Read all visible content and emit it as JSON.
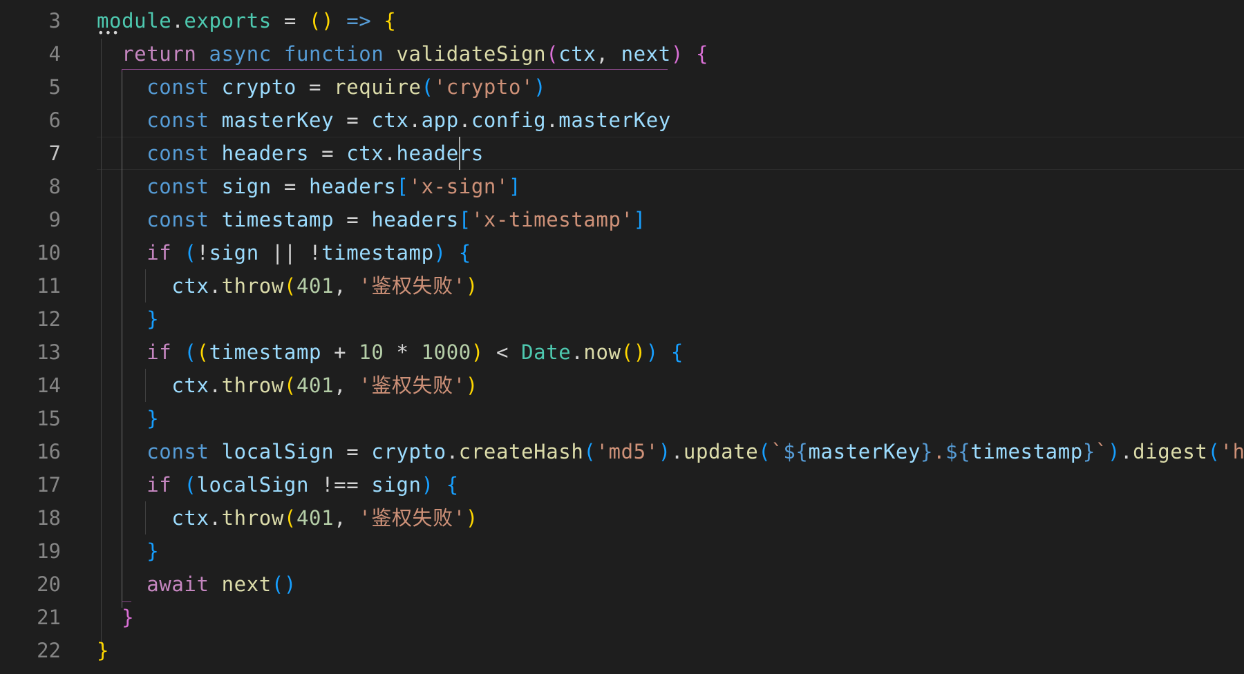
{
  "editor": {
    "active_line": 7,
    "line_numbers": [
      "3",
      "4",
      "5",
      "6",
      "7",
      "8",
      "9",
      "10",
      "11",
      "12",
      "13",
      "14",
      "15",
      "16",
      "17",
      "18",
      "19",
      "20",
      "21",
      "22"
    ],
    "lines": [
      [
        [
          "module",
          "t-type"
        ],
        [
          ".",
          "t-op"
        ],
        [
          "exports",
          "t-type"
        ],
        [
          " = ",
          "t-op"
        ],
        [
          "()",
          "t-b1"
        ],
        [
          " => ",
          "t-kw"
        ],
        [
          "{",
          "t-b1"
        ]
      ],
      [
        [
          "  ",
          "t-op"
        ],
        [
          "return",
          "t-ctl"
        ],
        [
          " ",
          "t-op"
        ],
        [
          "async",
          "t-kw"
        ],
        [
          " ",
          "t-op"
        ],
        [
          "function",
          "t-kw"
        ],
        [
          " ",
          "t-op"
        ],
        [
          "validateSign",
          "t-fn"
        ],
        [
          "(",
          "t-b2"
        ],
        [
          "ctx",
          "t-var"
        ],
        [
          ", ",
          "t-op"
        ],
        [
          "next",
          "t-var"
        ],
        [
          ")",
          "t-b2"
        ],
        [
          " ",
          "t-op"
        ],
        [
          "{",
          "t-b2"
        ]
      ],
      [
        [
          "    ",
          "t-op"
        ],
        [
          "const",
          "t-kw"
        ],
        [
          " ",
          "t-op"
        ],
        [
          "crypto",
          "t-var"
        ],
        [
          " = ",
          "t-op"
        ],
        [
          "require",
          "t-fn"
        ],
        [
          "(",
          "t-b3"
        ],
        [
          "'crypto'",
          "t-str"
        ],
        [
          ")",
          "t-b3"
        ]
      ],
      [
        [
          "    ",
          "t-op"
        ],
        [
          "const",
          "t-kw"
        ],
        [
          " ",
          "t-op"
        ],
        [
          "masterKey",
          "t-var"
        ],
        [
          " = ",
          "t-op"
        ],
        [
          "ctx",
          "t-var"
        ],
        [
          ".",
          "t-op"
        ],
        [
          "app",
          "t-var"
        ],
        [
          ".",
          "t-op"
        ],
        [
          "config",
          "t-var"
        ],
        [
          ".",
          "t-op"
        ],
        [
          "masterKey",
          "t-var"
        ]
      ],
      [
        [
          "    ",
          "t-op"
        ],
        [
          "const",
          "t-kw"
        ],
        [
          " ",
          "t-op"
        ],
        [
          "headers",
          "t-var"
        ],
        [
          " = ",
          "t-op"
        ],
        [
          "ctx",
          "t-var"
        ],
        [
          ".",
          "t-op"
        ],
        [
          "headers",
          "t-var"
        ]
      ],
      [
        [
          "    ",
          "t-op"
        ],
        [
          "const",
          "t-kw"
        ],
        [
          " ",
          "t-op"
        ],
        [
          "sign",
          "t-var"
        ],
        [
          " = ",
          "t-op"
        ],
        [
          "headers",
          "t-var"
        ],
        [
          "[",
          "t-b3"
        ],
        [
          "'x-sign'",
          "t-str"
        ],
        [
          "]",
          "t-b3"
        ]
      ],
      [
        [
          "    ",
          "t-op"
        ],
        [
          "const",
          "t-kw"
        ],
        [
          " ",
          "t-op"
        ],
        [
          "timestamp",
          "t-var"
        ],
        [
          " = ",
          "t-op"
        ],
        [
          "headers",
          "t-var"
        ],
        [
          "[",
          "t-b3"
        ],
        [
          "'x-timestamp'",
          "t-str"
        ],
        [
          "]",
          "t-b3"
        ]
      ],
      [
        [
          "    ",
          "t-op"
        ],
        [
          "if",
          "t-ctl"
        ],
        [
          " ",
          "t-op"
        ],
        [
          "(",
          "t-b3"
        ],
        [
          "!",
          "t-op"
        ],
        [
          "sign",
          "t-var"
        ],
        [
          " || ",
          "t-op"
        ],
        [
          "!",
          "t-op"
        ],
        [
          "timestamp",
          "t-var"
        ],
        [
          ")",
          "t-b3"
        ],
        [
          " ",
          "t-op"
        ],
        [
          "{",
          "t-b3"
        ]
      ],
      [
        [
          "      ",
          "t-op"
        ],
        [
          "ctx",
          "t-var"
        ],
        [
          ".",
          "t-op"
        ],
        [
          "throw",
          "t-fn"
        ],
        [
          "(",
          "t-b1"
        ],
        [
          "401",
          "t-num"
        ],
        [
          ", ",
          "t-op"
        ],
        [
          "'鉴权失败'",
          "t-str"
        ],
        [
          ")",
          "t-b1"
        ]
      ],
      [
        [
          "    ",
          "t-op"
        ],
        [
          "}",
          "t-b3"
        ]
      ],
      [
        [
          "    ",
          "t-op"
        ],
        [
          "if",
          "t-ctl"
        ],
        [
          " ",
          "t-op"
        ],
        [
          "(",
          "t-b3"
        ],
        [
          "(",
          "t-b1"
        ],
        [
          "timestamp",
          "t-var"
        ],
        [
          " + ",
          "t-op"
        ],
        [
          "10",
          "t-num"
        ],
        [
          " * ",
          "t-op"
        ],
        [
          "1000",
          "t-num"
        ],
        [
          ")",
          "t-b1"
        ],
        [
          " < ",
          "t-op"
        ],
        [
          "Date",
          "t-type"
        ],
        [
          ".",
          "t-op"
        ],
        [
          "now",
          "t-fn"
        ],
        [
          "()",
          "t-b1"
        ],
        [
          ")",
          "t-b3"
        ],
        [
          " ",
          "t-op"
        ],
        [
          "{",
          "t-b3"
        ]
      ],
      [
        [
          "      ",
          "t-op"
        ],
        [
          "ctx",
          "t-var"
        ],
        [
          ".",
          "t-op"
        ],
        [
          "throw",
          "t-fn"
        ],
        [
          "(",
          "t-b1"
        ],
        [
          "401",
          "t-num"
        ],
        [
          ", ",
          "t-op"
        ],
        [
          "'鉴权失败'",
          "t-str"
        ],
        [
          ")",
          "t-b1"
        ]
      ],
      [
        [
          "    ",
          "t-op"
        ],
        [
          "}",
          "t-b3"
        ]
      ],
      [
        [
          "    ",
          "t-op"
        ],
        [
          "const",
          "t-kw"
        ],
        [
          " ",
          "t-op"
        ],
        [
          "localSign",
          "t-var"
        ],
        [
          " = ",
          "t-op"
        ],
        [
          "crypto",
          "t-var"
        ],
        [
          ".",
          "t-op"
        ],
        [
          "createHash",
          "t-fn"
        ],
        [
          "(",
          "t-b3"
        ],
        [
          "'md5'",
          "t-str"
        ],
        [
          ")",
          "t-b3"
        ],
        [
          ".",
          "t-op"
        ],
        [
          "update",
          "t-fn"
        ],
        [
          "(",
          "t-b3"
        ],
        [
          "`",
          "t-str"
        ],
        [
          "${",
          "t-kw"
        ],
        [
          "masterKey",
          "t-var"
        ],
        [
          "}",
          "t-kw"
        ],
        [
          ".",
          "t-str"
        ],
        [
          "${",
          "t-kw"
        ],
        [
          "timestamp",
          "t-var"
        ],
        [
          "}",
          "t-kw"
        ],
        [
          "`",
          "t-str"
        ],
        [
          ")",
          "t-b3"
        ],
        [
          ".",
          "t-op"
        ],
        [
          "digest",
          "t-fn"
        ],
        [
          "(",
          "t-b3"
        ],
        [
          "'hex'",
          "t-str"
        ],
        [
          ")",
          "t-b3"
        ]
      ],
      [
        [
          "    ",
          "t-op"
        ],
        [
          "if",
          "t-ctl"
        ],
        [
          " ",
          "t-op"
        ],
        [
          "(",
          "t-b3"
        ],
        [
          "localSign",
          "t-var"
        ],
        [
          " !== ",
          "t-op"
        ],
        [
          "sign",
          "t-var"
        ],
        [
          ")",
          "t-b3"
        ],
        [
          " ",
          "t-op"
        ],
        [
          "{",
          "t-b3"
        ]
      ],
      [
        [
          "      ",
          "t-op"
        ],
        [
          "ctx",
          "t-var"
        ],
        [
          ".",
          "t-op"
        ],
        [
          "throw",
          "t-fn"
        ],
        [
          "(",
          "t-b1"
        ],
        [
          "401",
          "t-num"
        ],
        [
          ", ",
          "t-op"
        ],
        [
          "'鉴权失败'",
          "t-str"
        ],
        [
          ")",
          "t-b1"
        ]
      ],
      [
        [
          "    ",
          "t-op"
        ],
        [
          "}",
          "t-b3"
        ]
      ],
      [
        [
          "    ",
          "t-op"
        ],
        [
          "await",
          "t-ctl"
        ],
        [
          " ",
          "t-op"
        ],
        [
          "next",
          "t-fn"
        ],
        [
          "()",
          "t-b3"
        ]
      ],
      [
        [
          "  ",
          "t-op"
        ],
        [
          "}",
          "t-b2"
        ]
      ],
      [
        [
          "}",
          "t-b1"
        ]
      ]
    ],
    "colors": {
      "background": "#1e1e1e",
      "keyword": "#569cd6",
      "control": "#c586c0",
      "function": "#dcdcaa",
      "variable": "#9cdcfe",
      "string": "#ce9178",
      "number": "#b5cea8",
      "type": "#4ec9b0",
      "bracket_level1": "#ffd700",
      "bracket_level2": "#da70d6",
      "bracket_level3": "#179fff"
    }
  }
}
